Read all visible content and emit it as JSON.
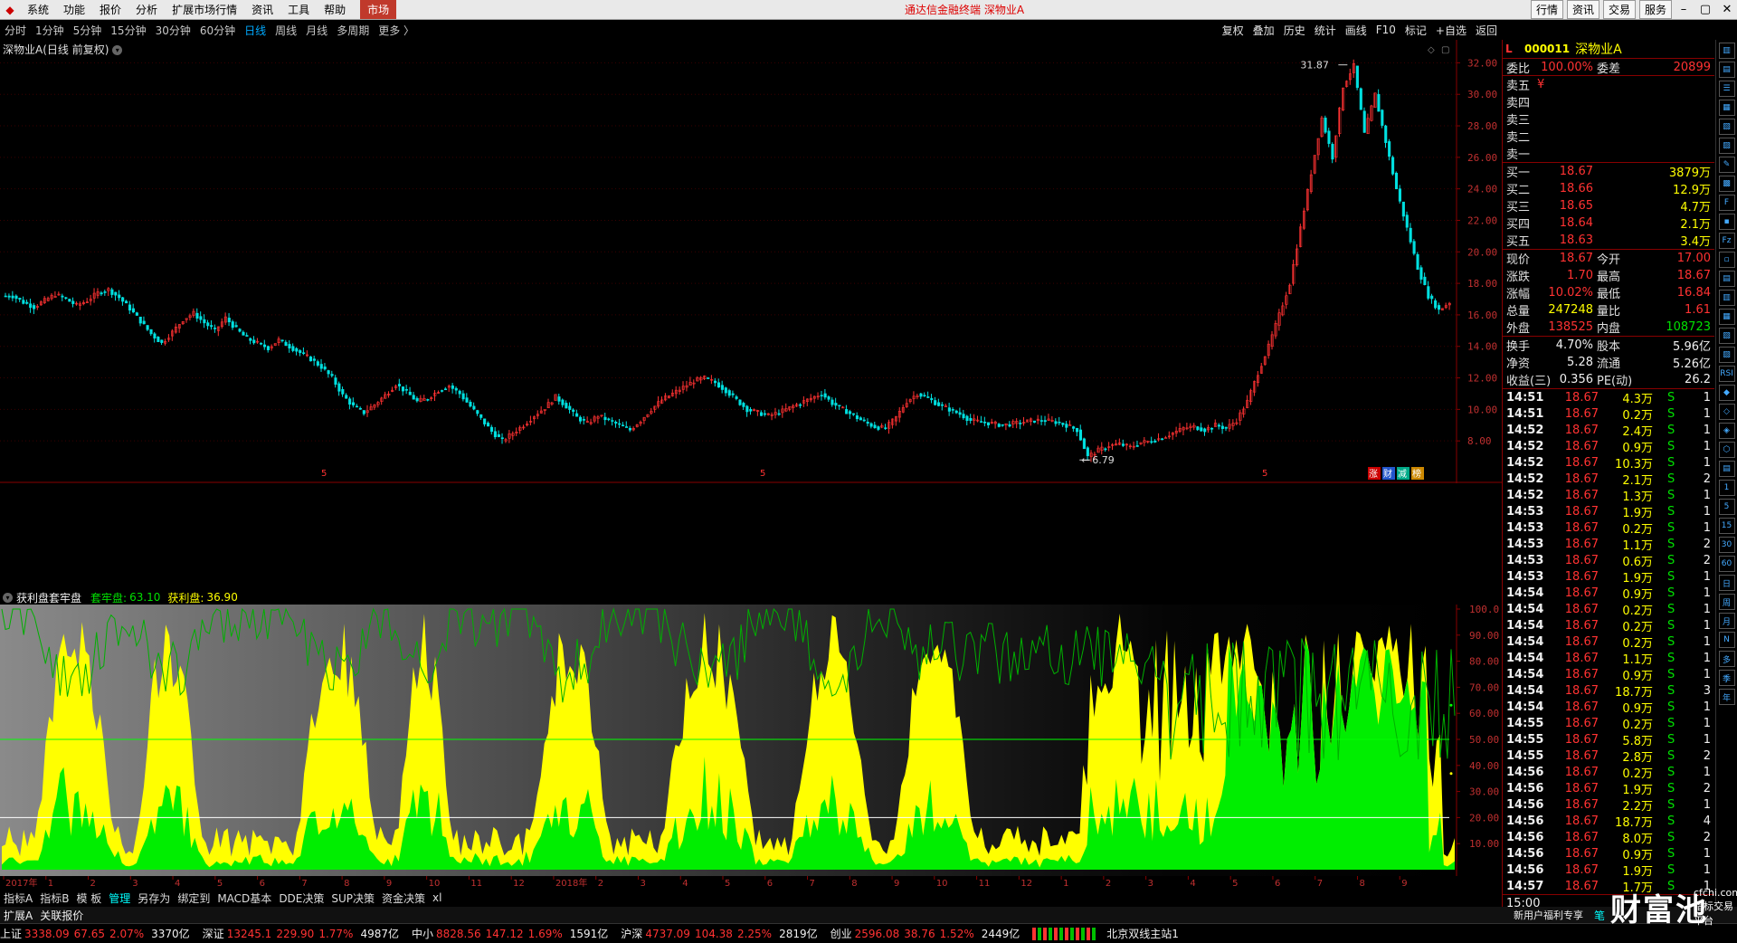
{
  "menubar": {
    "logo": "◆",
    "items": [
      "系统",
      "功能",
      "报价",
      "分析",
      "扩展市场行情",
      "资讯",
      "工具",
      "帮助"
    ],
    "market_tab": "市场",
    "title": "通达信金融终端  深物业A",
    "right_buttons": [
      "行情",
      "资讯",
      "交易",
      "服务"
    ],
    "window_controls": [
      "–",
      "▢",
      "✕"
    ]
  },
  "periods": [
    "分时",
    "1分钟",
    "5分钟",
    "15分钟",
    "30分钟",
    "60分钟",
    "日线",
    "周线",
    "月线",
    "多周期",
    "更多 〉"
  ],
  "active_period": "日线",
  "toolbar": [
    "复权",
    "叠加",
    "历史",
    "统计",
    "画线",
    "F10",
    "标记",
    "+自选",
    "返回"
  ],
  "chart_title": "深物业A(日线 前复权)",
  "chart_data": [
    {
      "type": "line",
      "title": "深物业A(日线 前复权)",
      "ylim": [
        6,
        33
      ],
      "y_ticks": [
        "32.00",
        "30.00",
        "28.00",
        "26.00",
        "24.00",
        "22.00",
        "20.00",
        "18.00",
        "16.00",
        "14.00",
        "12.00",
        "10.00",
        "8.00"
      ],
      "annotations": [
        {
          "label": "31.87",
          "kind": "high"
        },
        {
          "label": "6.79",
          "kind": "low"
        }
      ],
      "series": [
        {
          "values": [
            17.2,
            16.8,
            16.5,
            16.9,
            17.3,
            17.0,
            16.6,
            16.9,
            17.4,
            17.6,
            17.1,
            16.4,
            15.6,
            14.8,
            14.2,
            14.9,
            15.7,
            16.1,
            15.5,
            15.0,
            15.8,
            15.1,
            14.5,
            14.2,
            13.9,
            14.4,
            14.0,
            13.6,
            13.2,
            12.7,
            12.0,
            10.9,
            10.2,
            9.8,
            10.3,
            10.9,
            11.6,
            11.1,
            10.5,
            10.7,
            11.2,
            11.5,
            11.0,
            10.2,
            9.4,
            8.6,
            8.0,
            8.5,
            9.0,
            9.6,
            10.1,
            10.8,
            10.2,
            9.5,
            9.1,
            9.6,
            9.3,
            9.0,
            8.7,
            9.3,
            10.0,
            10.6,
            11.0,
            11.4,
            11.8,
            12.0,
            11.7,
            11.2,
            10.6,
            10.0,
            9.8,
            9.6,
            9.8,
            10.1,
            10.4,
            10.7,
            11.0,
            10.4,
            10.0,
            9.6,
            9.2,
            8.9,
            8.8,
            9.5,
            10.5,
            11.0,
            10.7,
            10.3,
            10.0,
            9.7,
            9.3,
            9.2,
            9.1,
            9.0,
            9.1,
            9.2,
            9.3,
            9.3,
            9.2,
            9.0,
            8.7,
            7.0,
            7.4,
            7.7,
            7.8,
            7.6,
            7.9,
            8.0,
            8.2,
            8.5,
            8.8,
            8.9,
            8.7,
            9.0,
            8.8,
            9.3,
            10.5,
            12.3,
            14.0,
            16.0,
            18.0,
            21.5,
            25.0,
            28.5,
            26.0,
            30.5,
            31.8,
            27.5,
            30.0,
            27.0,
            24.0,
            21.5,
            19.0,
            17.2,
            16.3,
            16.8
          ]
        }
      ]
    },
    {
      "type": "area",
      "title": "获利盘套牢盘",
      "ylim": [
        0,
        100
      ],
      "y_ticks": [
        "100.0",
        "90.00",
        "80.00",
        "70.00",
        "60.00",
        "50.00",
        "40.00",
        "30.00",
        "20.00",
        "10.00"
      ],
      "reference_lines": [
        50,
        20
      ],
      "series": [
        {
          "name": "套牢盘",
          "value": 63.1
        },
        {
          "name": "获利盘",
          "value": 36.9
        }
      ]
    }
  ],
  "period_markers": [
    "5",
    "5",
    "5"
  ],
  "corner_tags": [
    "涨",
    "财",
    "减",
    "榜"
  ],
  "indicator": {
    "name": "获利盘套牢盘",
    "tao_label": "套牢盘:",
    "tao_value": "63.10",
    "huo_label": "获利盘:",
    "huo_value": "36.90"
  },
  "time_axis": [
    "2017年",
    "1",
    "2",
    "3",
    "4",
    "5",
    "6",
    "7",
    "8",
    "9",
    "10",
    "11",
    "12",
    "2018年",
    "2",
    "3",
    "4",
    "5",
    "6",
    "7",
    "8",
    "9",
    "10",
    "11",
    "12",
    "1",
    "2",
    "3",
    "4",
    "5",
    "6",
    "7",
    "8",
    "9"
  ],
  "time_axis_right": "日线",
  "bottom_tabs": [
    "指标A",
    "指标B",
    "模 板",
    "管理",
    "另存为",
    "绑定到",
    "MACD基本",
    "DDE决策",
    "SUP决策",
    "资金决策",
    "xl"
  ],
  "bottom_tabs_active": "管理",
  "bottom_tabs2": [
    "扩展A",
    "关联报价"
  ],
  "bottom_right": [
    "新用户福利专享",
    "笔"
  ],
  "status": [
    {
      "name": "上证",
      "price": "3338.09",
      "chg": "67.65",
      "pct": "2.07%",
      "amt": "3370亿"
    },
    {
      "name": "深证",
      "price": "13245.1",
      "chg": "229.90",
      "pct": "1.77%",
      "amt": "4987亿"
    },
    {
      "name": "中小",
      "price": "8828.56",
      "chg": "147.12",
      "pct": "1.69%",
      "amt": "1591亿"
    },
    {
      "name": "沪深",
      "price": "4737.09",
      "chg": "104.38",
      "pct": "2.25%",
      "amt": "2819亿"
    },
    {
      "name": "创业",
      "price": "2596.08",
      "chg": "38.76",
      "pct": "1.52%",
      "amt": "2449亿"
    }
  ],
  "server": "北京双线主站1",
  "quote": {
    "flag": "L",
    "code": "000011",
    "name": "深物业A",
    "weibi_label": "委比",
    "weibi": "100.00%",
    "weicha_label": "委差",
    "weicha": "20899",
    "sells": [
      {
        "label": "卖五",
        "price": "¥",
        "vol": ""
      },
      {
        "label": "卖四",
        "price": "",
        "vol": ""
      },
      {
        "label": "卖三",
        "price": "",
        "vol": ""
      },
      {
        "label": "卖二",
        "price": "",
        "vol": ""
      },
      {
        "label": "卖一",
        "price": "",
        "vol": ""
      }
    ],
    "buys": [
      {
        "label": "买一",
        "price": "18.67",
        "vol": "3879万"
      },
      {
        "label": "买二",
        "price": "18.66",
        "vol": "12.9万"
      },
      {
        "label": "买三",
        "price": "18.65",
        "vol": "4.7万"
      },
      {
        "label": "买四",
        "price": "18.64",
        "vol": "2.1万"
      },
      {
        "label": "买五",
        "price": "18.63",
        "vol": "3.4万"
      }
    ],
    "stats": [
      {
        "l1": "现价",
        "v1": "18.67",
        "c1": "red",
        "l2": "今开",
        "v2": "17.00",
        "c2": "red"
      },
      {
        "l1": "涨跌",
        "v1": "1.70",
        "c1": "red",
        "l2": "最高",
        "v2": "18.67",
        "c2": "red"
      },
      {
        "l1": "涨幅",
        "v1": "10.02%",
        "c1": "red",
        "l2": "最低",
        "v2": "16.84",
        "c2": "red"
      },
      {
        "l1": "总量",
        "v1": "247248",
        "c1": "yellow",
        "l2": "量比",
        "v2": "1.61",
        "c2": "red"
      },
      {
        "l1": "外盘",
        "v1": "138525",
        "c1": "red",
        "l2": "内盘",
        "v2": "108723",
        "c2": "green"
      }
    ],
    "stats2": [
      {
        "l1": "换手",
        "v1": "4.70%",
        "l2": "股本",
        "v2": "5.96亿"
      },
      {
        "l1": "净资",
        "v1": "5.28",
        "l2": "流通",
        "v2": "5.26亿"
      },
      {
        "l1": "收益(三)",
        "v1": "0.356",
        "l2": "PE(动)",
        "v2": "26.2"
      }
    ],
    "ticks": [
      {
        "t": "14:51",
        "p": "18.67",
        "v": "4.3万",
        "s": "S",
        "n": "1"
      },
      {
        "t": "14:51",
        "p": "18.67",
        "v": "0.2万",
        "s": "S",
        "n": "1"
      },
      {
        "t": "14:52",
        "p": "18.67",
        "v": "2.4万",
        "s": "S",
        "n": "1"
      },
      {
        "t": "14:52",
        "p": "18.67",
        "v": "0.9万",
        "s": "S",
        "n": "1"
      },
      {
        "t": "14:52",
        "p": "18.67",
        "v": "10.3万",
        "s": "S",
        "n": "1"
      },
      {
        "t": "14:52",
        "p": "18.67",
        "v": "2.1万",
        "s": "S",
        "n": "2"
      },
      {
        "t": "14:52",
        "p": "18.67",
        "v": "1.3万",
        "s": "S",
        "n": "1"
      },
      {
        "t": "14:53",
        "p": "18.67",
        "v": "1.9万",
        "s": "S",
        "n": "1"
      },
      {
        "t": "14:53",
        "p": "18.67",
        "v": "0.2万",
        "s": "S",
        "n": "1"
      },
      {
        "t": "14:53",
        "p": "18.67",
        "v": "1.1万",
        "s": "S",
        "n": "2"
      },
      {
        "t": "14:53",
        "p": "18.67",
        "v": "0.6万",
        "s": "S",
        "n": "2"
      },
      {
        "t": "14:53",
        "p": "18.67",
        "v": "1.9万",
        "s": "S",
        "n": "1"
      },
      {
        "t": "14:54",
        "p": "18.67",
        "v": "0.9万",
        "s": "S",
        "n": "1"
      },
      {
        "t": "14:54",
        "p": "18.67",
        "v": "0.2万",
        "s": "S",
        "n": "1"
      },
      {
        "t": "14:54",
        "p": "18.67",
        "v": "0.2万",
        "s": "S",
        "n": "1"
      },
      {
        "t": "14:54",
        "p": "18.67",
        "v": "0.2万",
        "s": "S",
        "n": "1"
      },
      {
        "t": "14:54",
        "p": "18.67",
        "v": "1.1万",
        "s": "S",
        "n": "1"
      },
      {
        "t": "14:54",
        "p": "18.67",
        "v": "0.9万",
        "s": "S",
        "n": "1"
      },
      {
        "t": "14:54",
        "p": "18.67",
        "v": "18.7万",
        "s": "S",
        "n": "3"
      },
      {
        "t": "14:54",
        "p": "18.67",
        "v": "0.9万",
        "s": "S",
        "n": "1"
      },
      {
        "t": "14:55",
        "p": "18.67",
        "v": "0.2万",
        "s": "S",
        "n": "1"
      },
      {
        "t": "14:55",
        "p": "18.67",
        "v": "5.8万",
        "s": "S",
        "n": "1"
      },
      {
        "t": "14:55",
        "p": "18.67",
        "v": "2.8万",
        "s": "S",
        "n": "2"
      },
      {
        "t": "14:56",
        "p": "18.67",
        "v": "0.2万",
        "s": "S",
        "n": "1"
      },
      {
        "t": "14:56",
        "p": "18.67",
        "v": "1.9万",
        "s": "S",
        "n": "2"
      },
      {
        "t": "14:56",
        "p": "18.67",
        "v": "2.2万",
        "s": "S",
        "n": "1"
      },
      {
        "t": "14:56",
        "p": "18.67",
        "v": "18.7万",
        "s": "S",
        "n": "4"
      },
      {
        "t": "14:56",
        "p": "18.67",
        "v": "8.0万",
        "s": "S",
        "n": "2"
      },
      {
        "t": "14:56",
        "p": "18.67",
        "v": "0.9万",
        "s": "S",
        "n": "1"
      },
      {
        "t": "14:56",
        "p": "18.67",
        "v": "1.9万",
        "s": "S",
        "n": "1"
      },
      {
        "t": "14:57",
        "p": "18.67",
        "v": "1.7万",
        "s": "S",
        "n": "1"
      }
    ],
    "close_time": "15:00",
    "ticks_bottom": [
      "笔"
    ]
  },
  "side_icons": [
    "▥",
    "▤",
    "☰",
    "▦",
    "▧",
    "▨",
    "✎",
    "▩",
    "F",
    "▪",
    "Fz",
    "▫",
    "▤",
    "▥",
    "▦",
    "▧",
    "▨",
    "RSI",
    "◆",
    "◇",
    "◈",
    "⬡",
    "▤",
    "1",
    "5",
    "15",
    "30",
    "60",
    "日",
    "周",
    "月",
    "N",
    "多",
    "季",
    "年"
  ],
  "watermark": "财富池",
  "watermark_site": "cfchi.com",
  "watermark_tag": "指标交易平台",
  "colors": {
    "up": "#ff3232",
    "down": "#00e0e0",
    "tao": "#00ff00",
    "huo": "#ffff00",
    "axis_red": "#880000"
  }
}
